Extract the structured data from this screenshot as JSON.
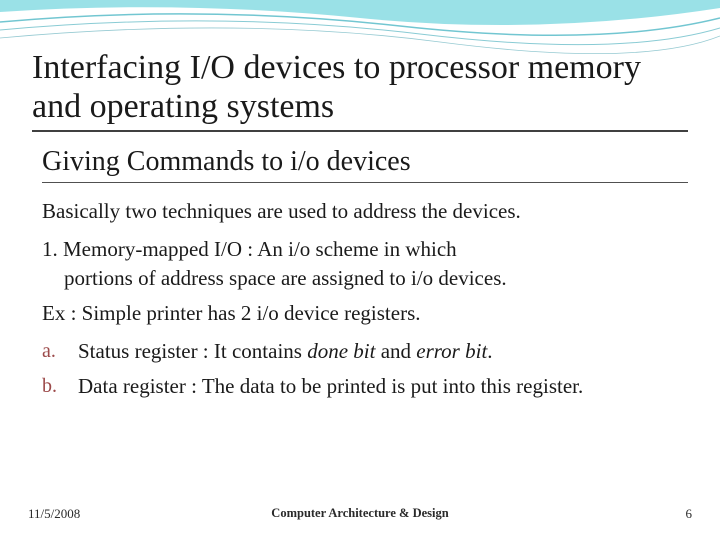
{
  "title": "Interfacing I/O devices to processor memory and operating systems",
  "subtitle": "Giving Commands to i/o devices",
  "intro": "Basically two techniques are used to address the devices.",
  "item1_lead": "1. Memory-mapped I/O : An i/o scheme in which",
  "item1_cont": "portions of address space are assigned to i/o devices.",
  "example": "Ex : Simple printer has 2 i/o device registers.",
  "letters": {
    "a_marker": "a.",
    "a_text_pre": "Status register : It contains ",
    "a_done": "done bit",
    "a_and": " and ",
    "a_error": "error bit",
    "a_period": ".",
    "b_marker": "b.",
    "b_text": "Data register   : The data to be printed is put into this register."
  },
  "footer": {
    "date": "11/5/2008",
    "center": "Computer Architecture & Design",
    "page": "6"
  }
}
